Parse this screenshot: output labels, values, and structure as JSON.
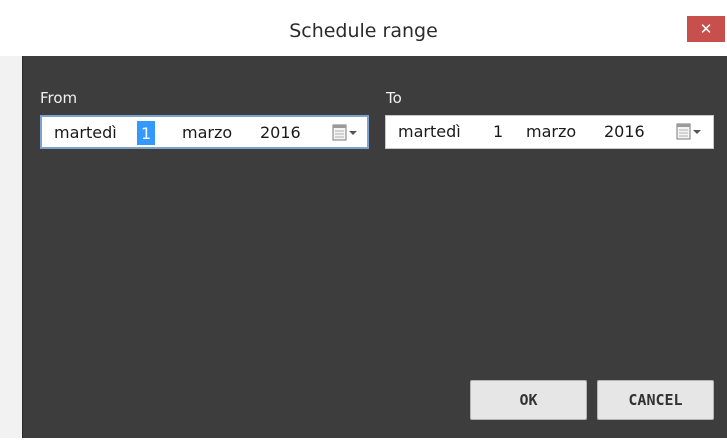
{
  "window": {
    "title": "Schedule range",
    "close_glyph": "✕"
  },
  "from": {
    "label": "From",
    "weekday": "martedì",
    "day": "1",
    "month": "marzo",
    "year": "2016",
    "selected_segment": "day",
    "icon": "calendar-dropdown-icon"
  },
  "to": {
    "label": "To",
    "weekday": "martedì",
    "day": "1",
    "month": "marzo",
    "year": "2016",
    "icon": "calendar-dropdown-icon"
  },
  "buttons": {
    "ok": "OK",
    "cancel": "CANCEL"
  },
  "colors": {
    "dialog_background": "#3d3d3d",
    "close_button": "#c7504d",
    "selection": "#3399ff",
    "focus_border": "#7da2ce"
  }
}
